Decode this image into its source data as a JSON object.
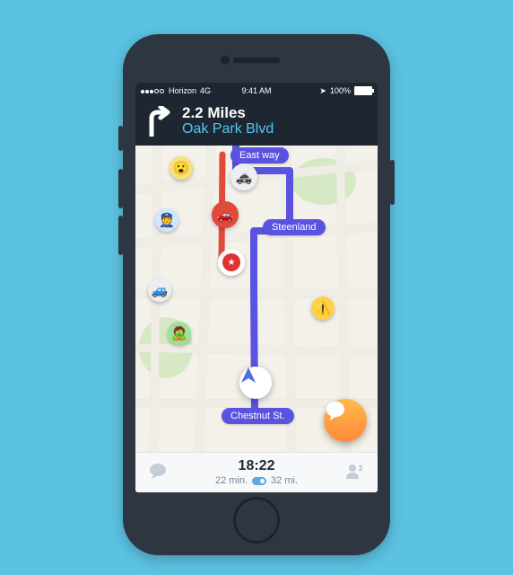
{
  "status_bar": {
    "carrier": "Horizon",
    "network": "4G",
    "time": "9:41 AM",
    "battery": "100%"
  },
  "nav": {
    "distance": "2.2 Miles",
    "street": "Oak Park Blvd"
  },
  "labels": {
    "east_way": "East way",
    "steenland": "Steenland",
    "chestnut": "Chestnut St."
  },
  "bottom": {
    "eta": "18:22",
    "time_remaining": "22 min.",
    "distance_remaining": "32 mi."
  },
  "icons": {
    "turn": "turn-right",
    "cursor": "nav-arrow",
    "fab": "speech-bubble",
    "left": "waze-mood",
    "right": "friends"
  }
}
